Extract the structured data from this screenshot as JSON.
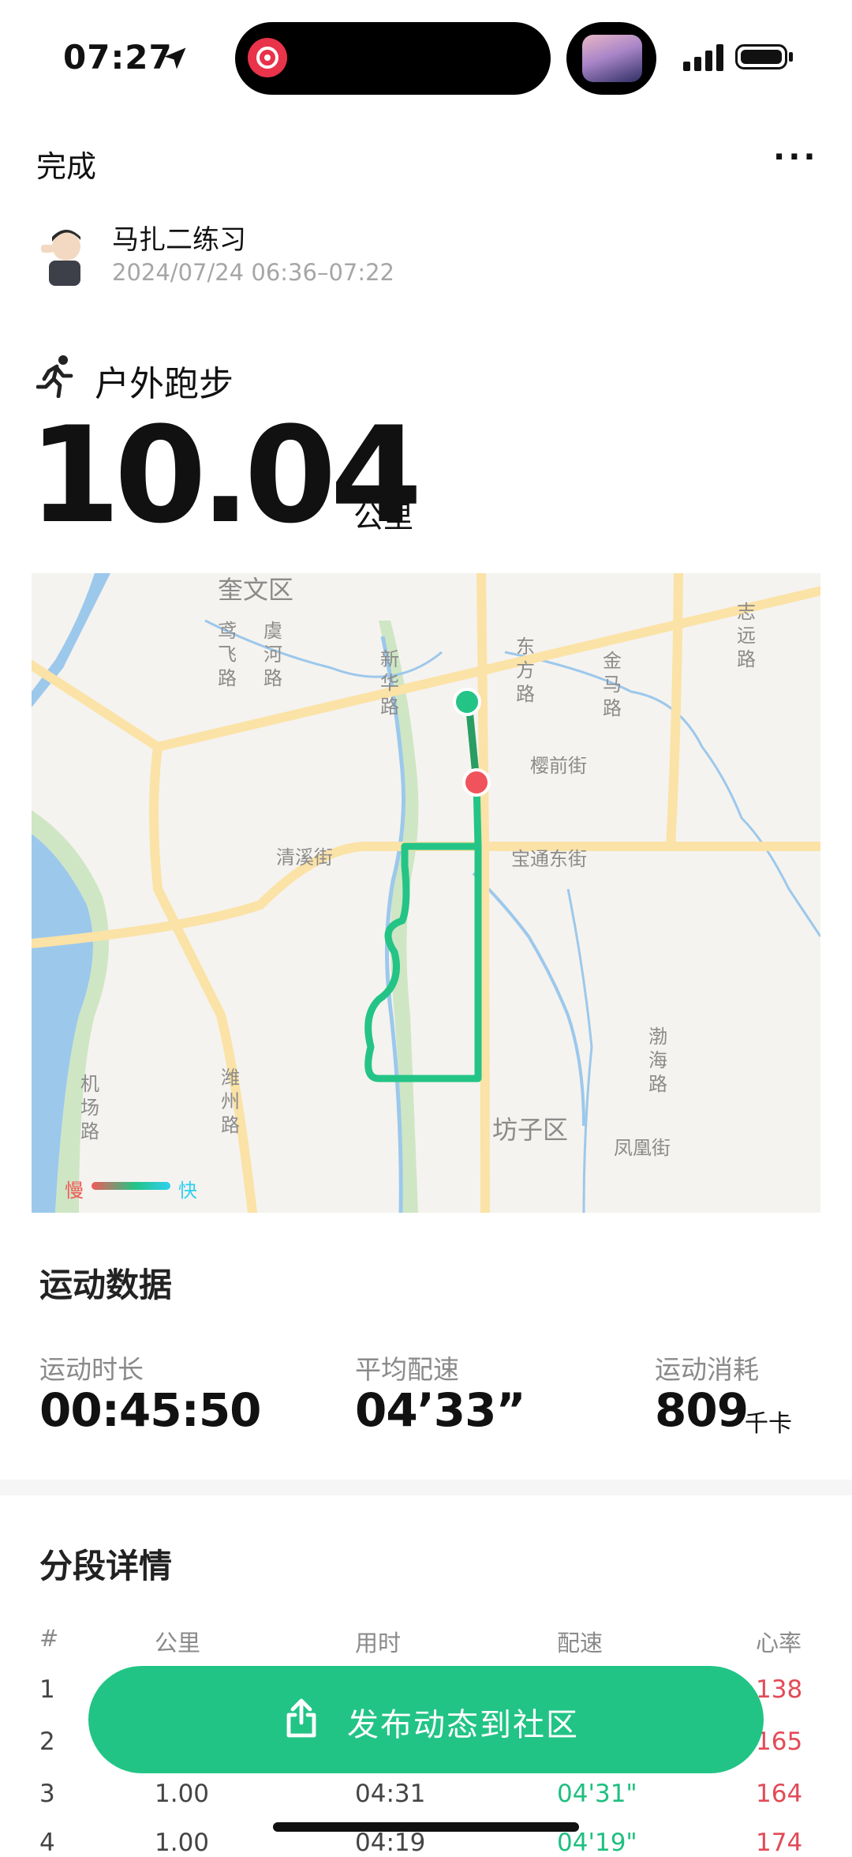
{
  "status_bar": {
    "time": "07:27"
  },
  "header": {
    "done_label": "完成",
    "more_label": "···"
  },
  "user": {
    "name": "马扎二练习",
    "time_range": "2024/07/24 06:36–07:22"
  },
  "workout": {
    "type": "户外跑步",
    "distance": "10.04",
    "distance_unit": "公里"
  },
  "map": {
    "labels": {
      "zhiwen": "奎文区",
      "yuanfei": "鸢\n飞\n路",
      "yuhe": "虞\n河\n路",
      "xinhua": "新\n华\n路",
      "dongfang": "东\n方\n路",
      "jinma": "金\n马\n路",
      "zhiyuan": "志\n远\n路",
      "yingqian": "樱前街",
      "qingxi": "清溪街",
      "baotong": "宝通东街",
      "bohai": "渤\n海\n路",
      "jichang": "机\n场\n路",
      "weizhou": "潍\n州\n路",
      "fangzi": "坊子区",
      "fenghuang": "凤凰街"
    },
    "legend": {
      "slow": "慢",
      "fast": "快"
    },
    "route_colors": {
      "start": "#24c486",
      "end": "#f0535c",
      "path": "#24c486"
    }
  },
  "stats": {
    "title": "运动数据",
    "duration": {
      "label": "运动时长",
      "value": "00:45:50"
    },
    "pace": {
      "label": "平均配速",
      "value": "04’33”"
    },
    "calories": {
      "label": "运动消耗",
      "value": "809",
      "unit": "千卡"
    }
  },
  "splits": {
    "title": "分段详情",
    "headers": {
      "index": "#",
      "km": "公里",
      "time": "用时",
      "pace": "配速",
      "heart": "心率"
    },
    "rows": [
      {
        "index": "1",
        "km": "",
        "time": "",
        "pace": "",
        "heart": "138"
      },
      {
        "index": "2",
        "km": "",
        "time": "",
        "pace": "",
        "heart": "165"
      },
      {
        "index": "3",
        "km": "1.00",
        "time": "04:31",
        "pace": "04'31\"",
        "heart": "164"
      },
      {
        "index": "4",
        "km": "1.00",
        "time": "04:19",
        "pace": "04'19\"",
        "heart": "174"
      }
    ]
  },
  "cta": {
    "label": "发布动态到社区"
  },
  "colors": {
    "accent": "#22c486",
    "heart_rate": "#e24b57"
  }
}
